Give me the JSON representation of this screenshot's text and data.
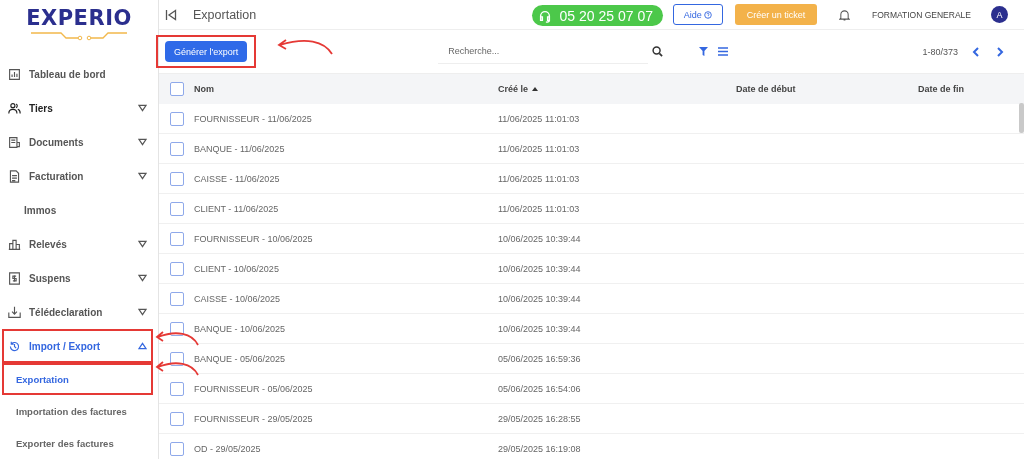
{
  "logo": {
    "text": "EXPERIO"
  },
  "sidebar": {
    "items": [
      {
        "label": "Tableau de bord",
        "kind": "item",
        "expandable": false,
        "selected": false,
        "highlighted": false
      },
      {
        "label": "Tiers",
        "kind": "item",
        "expandable": true,
        "expanded": false,
        "selected": false,
        "highlighted": false
      },
      {
        "label": "Documents",
        "kind": "item",
        "expandable": true,
        "expanded": false,
        "selected": false,
        "highlighted": false
      },
      {
        "label": "Facturation",
        "kind": "item",
        "expandable": true,
        "expanded": false,
        "selected": false,
        "highlighted": false
      },
      {
        "label": "Immos",
        "kind": "plain",
        "expandable": false,
        "selected": false,
        "highlighted": false
      },
      {
        "label": "Relevés",
        "kind": "item",
        "expandable": true,
        "expanded": false,
        "selected": false,
        "highlighted": false
      },
      {
        "label": "Suspens",
        "kind": "item",
        "expandable": true,
        "expanded": false,
        "selected": false,
        "highlighted": false
      },
      {
        "label": "Télédeclaration",
        "kind": "item",
        "expandable": true,
        "expanded": false,
        "selected": false,
        "highlighted": false
      },
      {
        "label": "Import / Export",
        "kind": "item",
        "expandable": true,
        "expanded": true,
        "selected": true,
        "highlighted": true,
        "children": [
          {
            "label": "Exportation",
            "selected": true,
            "highlighted": true
          },
          {
            "label": "Importation des factures",
            "selected": false,
            "highlighted": false
          },
          {
            "label": "Exporter des factures",
            "selected": false,
            "highlighted": false
          }
        ]
      }
    ]
  },
  "header": {
    "title": "Exportation",
    "phone": "05 20 25 07 07",
    "help": "Aide",
    "ticket": "Créer un ticket",
    "company": "FORMATION GENERALE",
    "avatar": "A"
  },
  "toolbar": {
    "export_button": {
      "label": "Générer l'export",
      "highlighted": true
    },
    "search": {
      "placeholder": "Recherche..."
    },
    "range": "1-80/373"
  },
  "table": {
    "columns": [
      {
        "label": "Nom",
        "sorted": false
      },
      {
        "label": "Créé le",
        "sorted": true
      },
      {
        "label": "Date de début",
        "sorted": false
      },
      {
        "label": "Date de fin",
        "sorted": false
      }
    ],
    "header_checked": false,
    "rows": [
      {
        "name": "FOURNISSEUR - 11/06/2025",
        "created": "11/06/2025 11:01:03",
        "checked": false
      },
      {
        "name": "BANQUE - 11/06/2025",
        "created": "11/06/2025 11:01:03",
        "checked": false
      },
      {
        "name": "CAISSE - 11/06/2025",
        "created": "11/06/2025 11:01:03",
        "checked": false
      },
      {
        "name": "CLIENT - 11/06/2025",
        "created": "11/06/2025 11:01:03",
        "checked": false
      },
      {
        "name": "FOURNISSEUR - 10/06/2025",
        "created": "10/06/2025 10:39:44",
        "checked": false
      },
      {
        "name": "CLIENT - 10/06/2025",
        "created": "10/06/2025 10:39:44",
        "checked": false
      },
      {
        "name": "CAISSE - 10/06/2025",
        "created": "10/06/2025 10:39:44",
        "checked": false
      },
      {
        "name": "BANQUE - 10/06/2025",
        "created": "10/06/2025 10:39:44",
        "checked": false
      },
      {
        "name": "BANQUE - 05/06/2025",
        "created": "05/06/2025 16:59:36",
        "checked": false
      },
      {
        "name": "FOURNISSEUR - 05/06/2025",
        "created": "05/06/2025 16:54:06",
        "checked": false
      },
      {
        "name": "FOURNISSEUR - 29/05/2025",
        "created": "29/05/2025 16:28:55",
        "checked": false
      },
      {
        "name": "OD - 29/05/2025",
        "created": "29/05/2025 16:19:08",
        "checked": false
      }
    ]
  }
}
